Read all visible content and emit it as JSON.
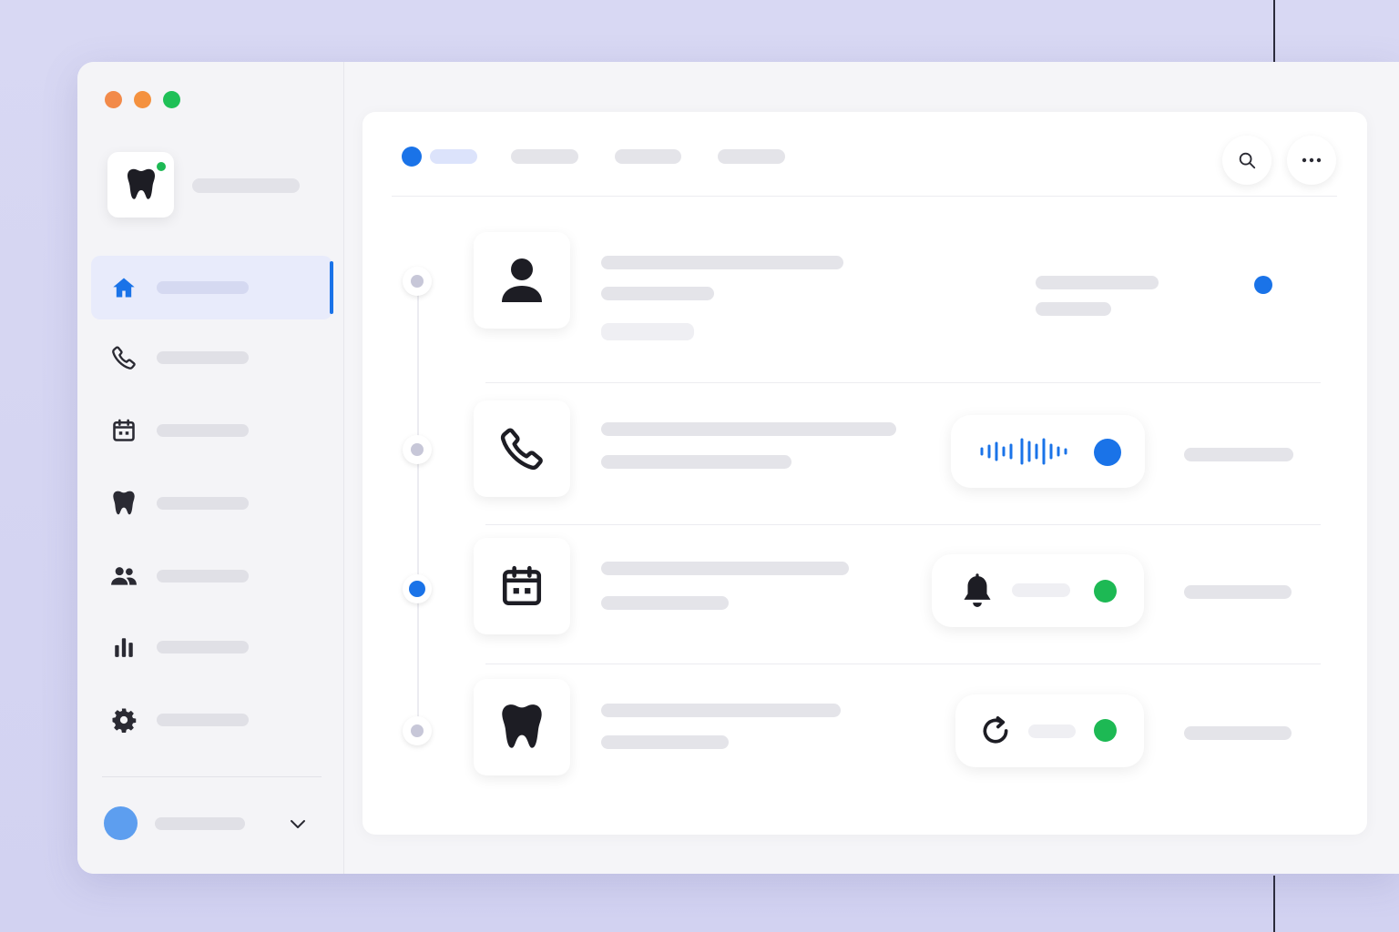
{
  "colors": {
    "accent_blue": "#1a73e8",
    "status_green": "#1db954",
    "avatar_blue": "#5d9eef",
    "traffic_red": "#f28a4a",
    "traffic_yellow": "#f4913f",
    "traffic_green": "#1fc057",
    "icon_dark": "#1d1d24"
  },
  "window": {
    "traffic_lights": [
      "close",
      "minimize",
      "maximize"
    ]
  },
  "sidebar": {
    "logo_icon": "tooth-icon",
    "logo_status": "online",
    "nav": [
      {
        "id": "home",
        "icon": "home-icon",
        "active": true
      },
      {
        "id": "calls",
        "icon": "phone-icon",
        "active": false
      },
      {
        "id": "calendar",
        "icon": "calendar-icon",
        "active": false
      },
      {
        "id": "dental",
        "icon": "tooth-icon",
        "active": false
      },
      {
        "id": "patients",
        "icon": "users-icon",
        "active": false
      },
      {
        "id": "reports",
        "icon": "bar-chart-icon",
        "active": false
      },
      {
        "id": "settings",
        "icon": "gear-icon",
        "active": false
      }
    ],
    "user": {
      "avatar": "avatar",
      "menu_icon": "chevron-down-icon"
    }
  },
  "main": {
    "tabs": [
      {
        "id": "tab-1",
        "active": true
      },
      {
        "id": "tab-2",
        "active": false
      },
      {
        "id": "tab-3",
        "active": false
      },
      {
        "id": "tab-4",
        "active": false
      }
    ],
    "actions": [
      {
        "id": "search",
        "icon": "search-icon"
      },
      {
        "id": "more",
        "icon": "more-horizontal-icon"
      }
    ],
    "timeline": [
      {
        "id": "patient",
        "icon": "person-icon",
        "node_active": false,
        "status": "unread"
      },
      {
        "id": "call",
        "icon": "phone-icon",
        "node_active": false,
        "widget": "voice-waveform",
        "status": "recording"
      },
      {
        "id": "appointment",
        "icon": "calendar-icon",
        "node_active": true,
        "widget": "bell-icon",
        "status": "confirmed"
      },
      {
        "id": "treatment",
        "icon": "tooth-icon",
        "node_active": false,
        "widget": "refresh-icon",
        "status": "synced"
      }
    ]
  }
}
